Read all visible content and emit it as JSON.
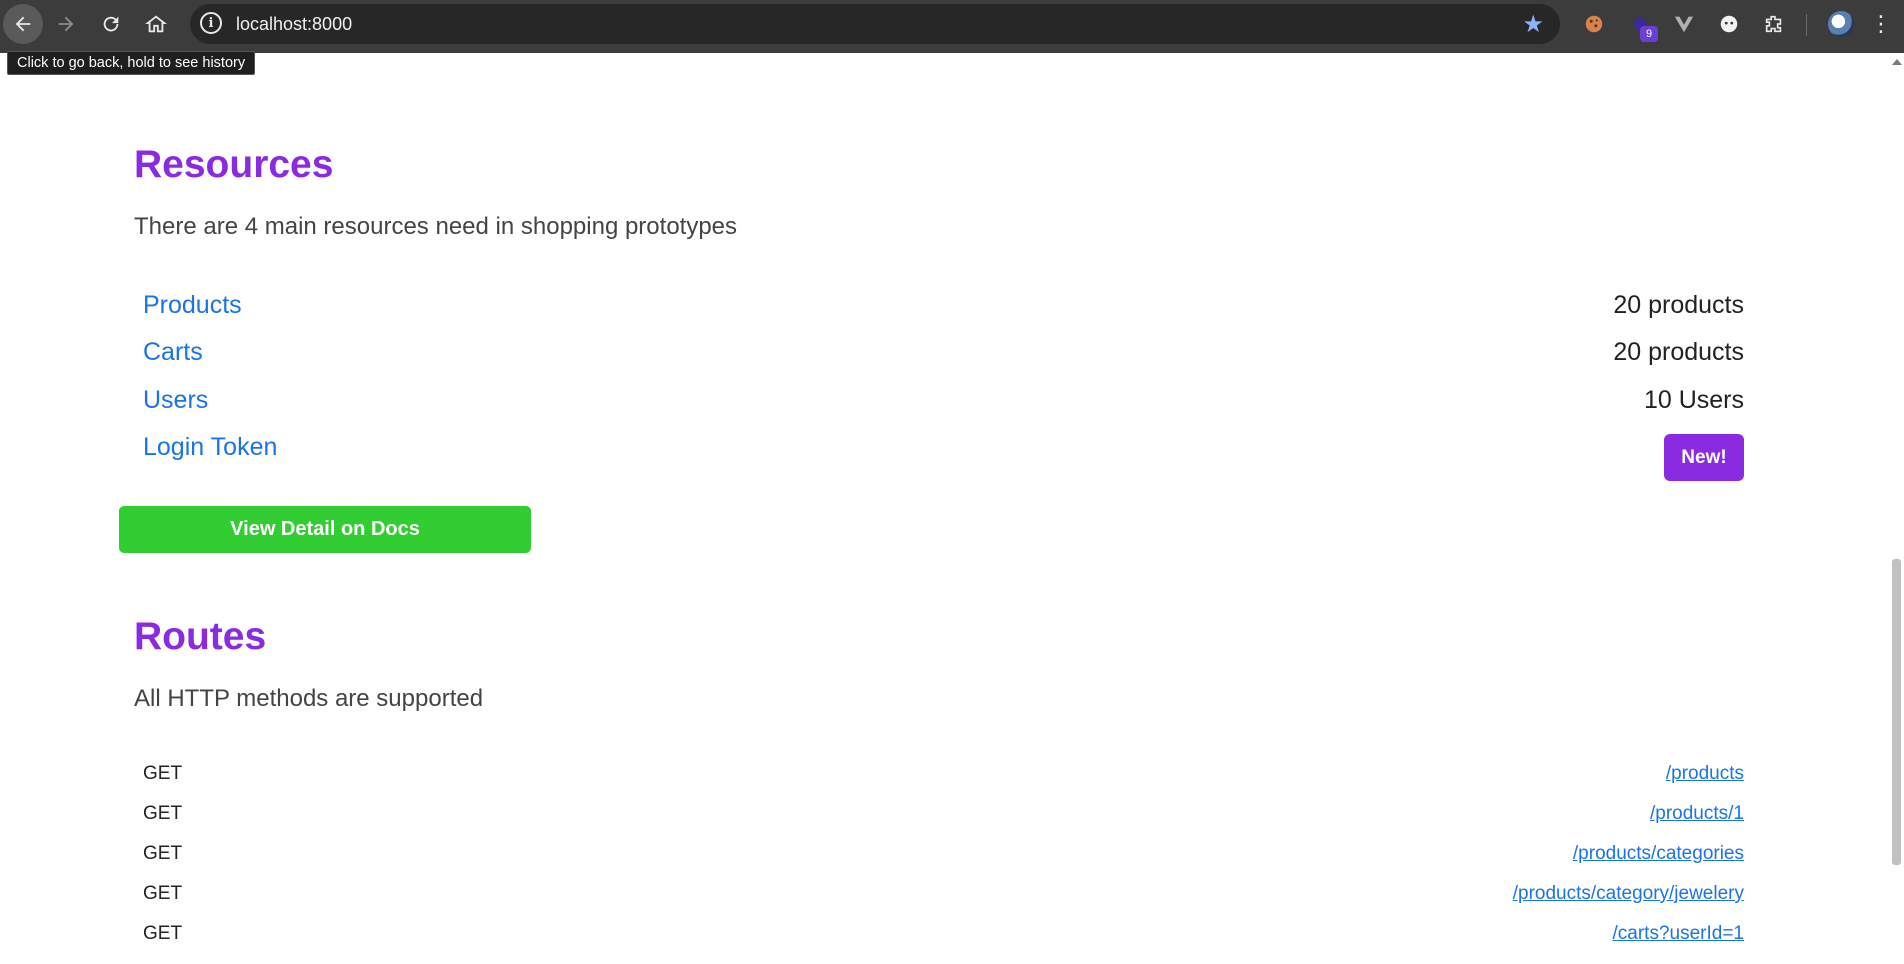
{
  "browser": {
    "url": "localhost:8000",
    "tooltip": "Click to go back, hold to see history",
    "extension_badge": "9",
    "icons": [
      "back-arrow-icon",
      "forward-arrow-icon",
      "reload-icon",
      "home-icon",
      "site-info-icon",
      "bookmark-star-icon",
      "cookie-extension-icon",
      "extension-icon",
      "vue-devtools-icon",
      "face-extension-icon",
      "puzzle-extensions-icon",
      "profile-avatar-icon",
      "menu-dots-icon"
    ]
  },
  "resources": {
    "title": "Resources",
    "description": "There are 4 main resources need in shopping prototypes",
    "items": [
      {
        "label": "Products",
        "count": "20 products"
      },
      {
        "label": "Carts",
        "count": "20 products"
      },
      {
        "label": "Users",
        "count": "10 Users"
      },
      {
        "label": "Login Token",
        "badge": "New!"
      }
    ],
    "docs_button": "View Detail on Docs"
  },
  "routes": {
    "title": "Routes",
    "description": "All HTTP methods are supported",
    "items": [
      {
        "method": "GET",
        "path": "/products"
      },
      {
        "method": "GET",
        "path": "/products/1"
      },
      {
        "method": "GET",
        "path": "/products/categories"
      },
      {
        "method": "GET",
        "path": "/products/category/jewelery"
      },
      {
        "method": "GET",
        "path": "/carts?userId=1"
      }
    ]
  },
  "colors": {
    "heading": "#8a2be2",
    "link": "#1a73e8",
    "docs_button": "#32cd32",
    "new_badge": "#8a2be2"
  }
}
